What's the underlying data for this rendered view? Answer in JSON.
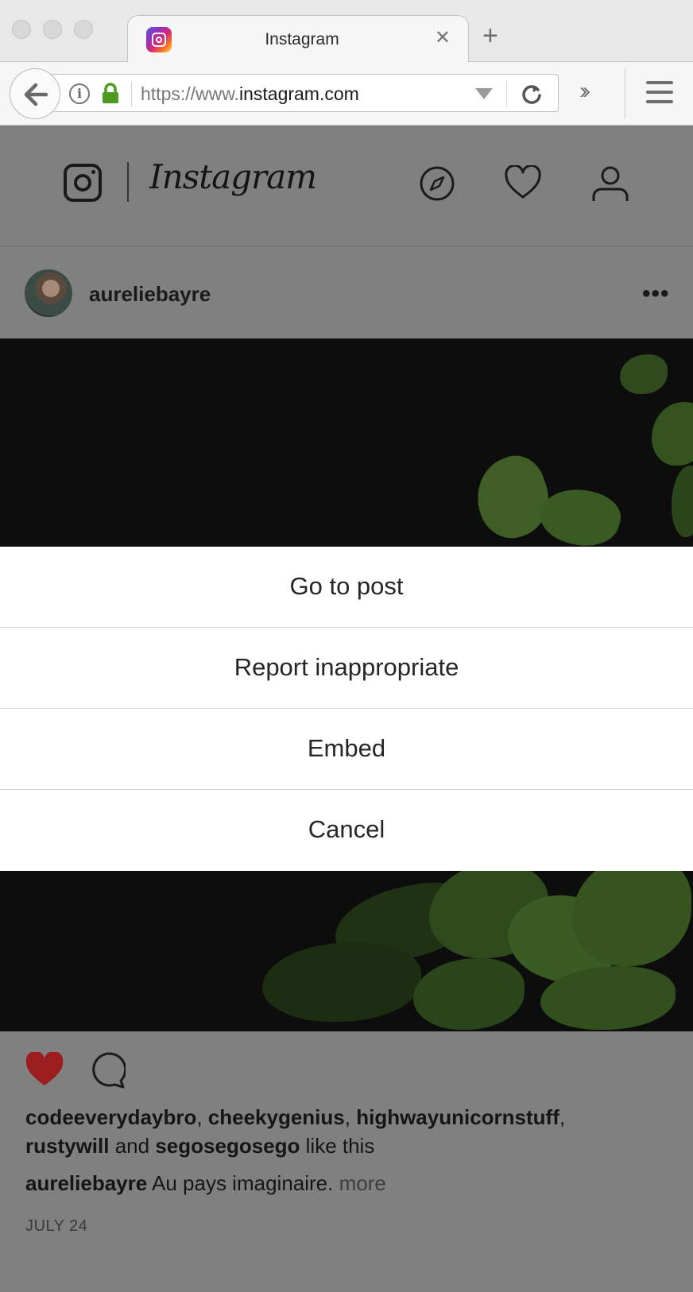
{
  "browser": {
    "tab_title": "Instagram",
    "tab_close": "✕",
    "new_tab": "+",
    "url_prefix": "https://www.",
    "url_domain": "instagram.com"
  },
  "header": {
    "wordmark": "Instagram",
    "icons": [
      "instagram-camera-icon",
      "compass-icon",
      "heart-icon",
      "profile-icon"
    ]
  },
  "post": {
    "username": "aureliebayre",
    "liked_by": [
      "codeeverydaybro",
      "cheekygenius",
      "highwayunicornstuff",
      "rustywill",
      "segosegosego"
    ],
    "likes_connector": "and",
    "likes_suffix": "like this",
    "caption_user": "aureliebayre",
    "caption_text": "Au pays imaginaire.",
    "caption_more": "more",
    "date": "JULY 24",
    "like_color": "#9b1d1d"
  },
  "menu": {
    "items": [
      "Go to post",
      "Report inappropriate",
      "Embed",
      "Cancel"
    ]
  }
}
